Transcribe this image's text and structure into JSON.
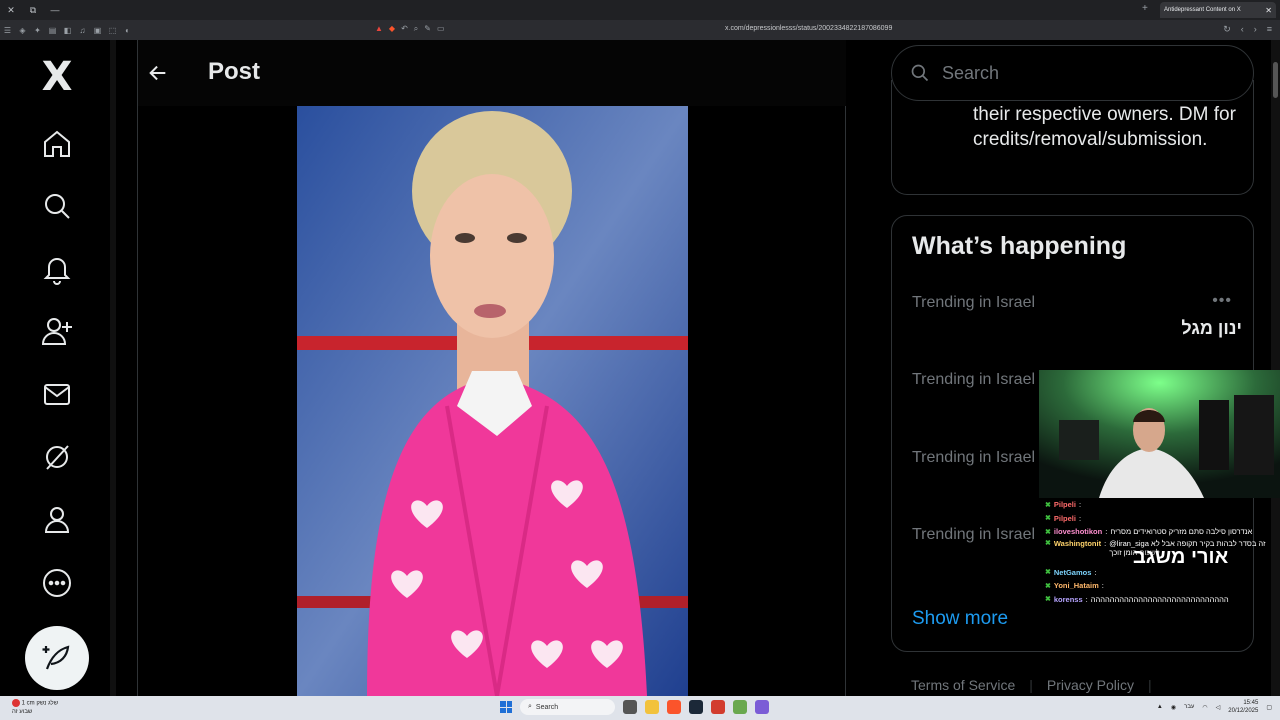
{
  "browser": {
    "tab_title": "Antidepressant Content on X",
    "url": "x.com/depressionlesss/status/2002334822187086099"
  },
  "nav": {
    "logo": "X"
  },
  "main": {
    "title": "Post"
  },
  "sidebar": {
    "search_placeholder": "Search",
    "about_text": "their respective owners. DM for credits/removal/submission.",
    "happening_title": "What’s happening",
    "trends": [
      {
        "meta": "Trending in Israel",
        "name": "ינון מגל"
      },
      {
        "meta": "Trending in Israel",
        "name": ""
      },
      {
        "meta": "Trending in Israel",
        "name": ""
      },
      {
        "meta": "Trending in Israel",
        "name": ""
      }
    ],
    "show_more": "Show more",
    "footer_links": [
      "Terms of Service",
      "Privacy Policy"
    ]
  },
  "stream_overlay": {
    "name": "אורי משגב",
    "chat": [
      {
        "user": "Pilpeli",
        "message": ""
      },
      {
        "user": "Pilpeli",
        "message": ""
      },
      {
        "user": "iloveshotikon",
        "message": "אנדרסון סילבה סתם מזריק סטרואידים מסריח"
      },
      {
        "user": "Washingtonit",
        "message": "@liran_siga זה בסדר לבהות בקיר תקופה אבל לא לשכוח הומן זוכך"
      },
      {
        "user": "NetGamos",
        "message": ""
      },
      {
        "user": "Yoni_Hataim",
        "message": ""
      },
      {
        "user": "korenss",
        "message": "ההההההההההההההההההההההההההההה"
      }
    ]
  },
  "taskbar": {
    "weather_line1": "1 cm שלג נשק",
    "weather_line2": "שבוע זה",
    "search_label": "Search",
    "lang": "עבר",
    "time": "15:45",
    "date": "20/12/2025"
  },
  "colors": {
    "accent": "#1d9bf0",
    "background": "#000000",
    "border": "#2f3336",
    "muted_text": "#71767b"
  }
}
